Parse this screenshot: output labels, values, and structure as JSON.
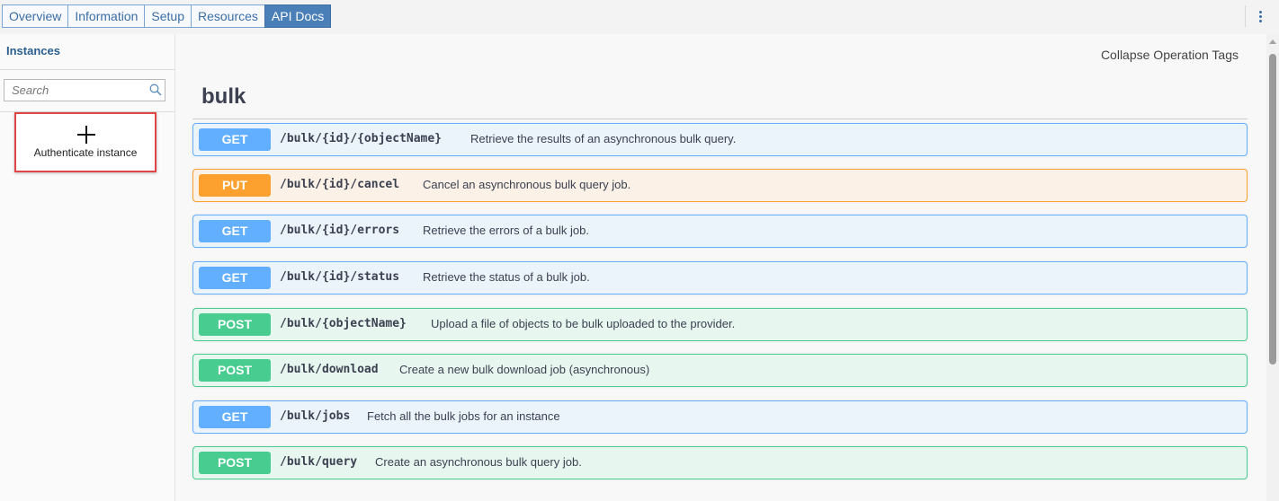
{
  "tabs": [
    {
      "label": "Overview",
      "active": false
    },
    {
      "label": "Information",
      "active": false
    },
    {
      "label": "Setup",
      "active": false
    },
    {
      "label": "Resources",
      "active": false
    },
    {
      "label": "API Docs",
      "active": true
    }
  ],
  "sidebar": {
    "title": "Instances",
    "search_placeholder": "Search",
    "auth_button_label": "Authenticate instance"
  },
  "main": {
    "collapse_label": "Collapse Operation Tags",
    "tag": "bulk",
    "operations": [
      {
        "method": "GET",
        "path": "/bulk/{id}/{objectName}",
        "description": "Retrieve the results of an asynchronous bulk query."
      },
      {
        "method": "PUT",
        "path": "/bulk/{id}/cancel",
        "description": "Cancel an asynchronous bulk query job."
      },
      {
        "method": "GET",
        "path": "/bulk/{id}/errors",
        "description": "Retrieve the errors of a bulk job."
      },
      {
        "method": "GET",
        "path": "/bulk/{id}/status",
        "description": "Retrieve the status of a bulk job."
      },
      {
        "method": "POST",
        "path": "/bulk/{objectName}",
        "description": "Upload a file of objects to be bulk uploaded to the provider."
      },
      {
        "method": "POST",
        "path": "/bulk/download",
        "description": "Create a new bulk download job (asynchronous)"
      },
      {
        "method": "GET",
        "path": "/bulk/jobs",
        "description": "Fetch all the bulk jobs for an instance"
      },
      {
        "method": "POST",
        "path": "/bulk/query",
        "description": "Create an asynchronous bulk query job."
      }
    ]
  },
  "colors": {
    "get": "#61affe",
    "put": "#fca130",
    "post": "#49cc90",
    "tab_active": "#4a7fb8",
    "highlight": "#e04646"
  },
  "icons": {
    "search": "search-icon",
    "add": "plus-icon",
    "menu": "kebab-menu-icon"
  }
}
